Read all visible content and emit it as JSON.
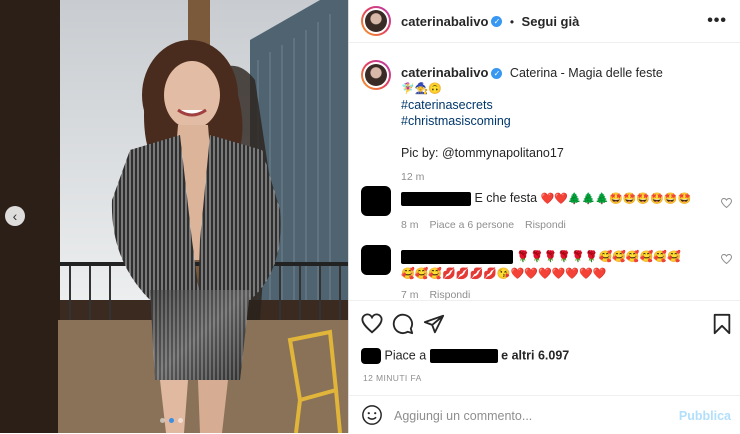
{
  "post": {
    "username": "caterinabalivo",
    "follow_sep": "•",
    "follow_label": "Segui già",
    "more_label": "•••"
  },
  "caption": {
    "username": "caterinabalivo",
    "text": "Caterina - Magia delle feste",
    "emoji_line": "🧚‍♀️🧙🙃",
    "hashtags": [
      "#caterinasecrets",
      "#christmasiscoming"
    ],
    "credit": "Pic by: @tommynapolitano17",
    "time": "12 m"
  },
  "comments": [
    {
      "text": "E che festa",
      "emojis": "❤️❤️🌲🌲🌲🤩🤩🤩🤩🤩🤩",
      "time": "8 m",
      "likes": "Piace a 6 persone",
      "reply": "Rispondi"
    },
    {
      "emojis_line1": "🌹🌹🌹🌹🌹🌹🥰🥰🥰🥰🥰🥰",
      "emojis_line2": "🥰🥰🥰💋💋💋💋😘❤️❤️❤️❤️❤️❤️❤️",
      "time": "7 m",
      "reply": "Rispondi"
    }
  ],
  "likes_bar": {
    "prefix": "Piace a",
    "suffix": "e altri 6.097",
    "time": "12 MINUTI FA"
  },
  "add_comment": {
    "placeholder": "Aggiungi un commento...",
    "publish": "Pubblica"
  },
  "icons": {
    "like": "heart-icon",
    "comment": "comment-icon",
    "share": "share-icon",
    "save": "bookmark-icon",
    "emoji": "emoji-icon",
    "prev": "chevron-left-icon"
  },
  "colors": {
    "link": "#00376b",
    "verified": "#3897f0",
    "heart": "#ed4956",
    "publish_disabled": "#b2dffc"
  }
}
